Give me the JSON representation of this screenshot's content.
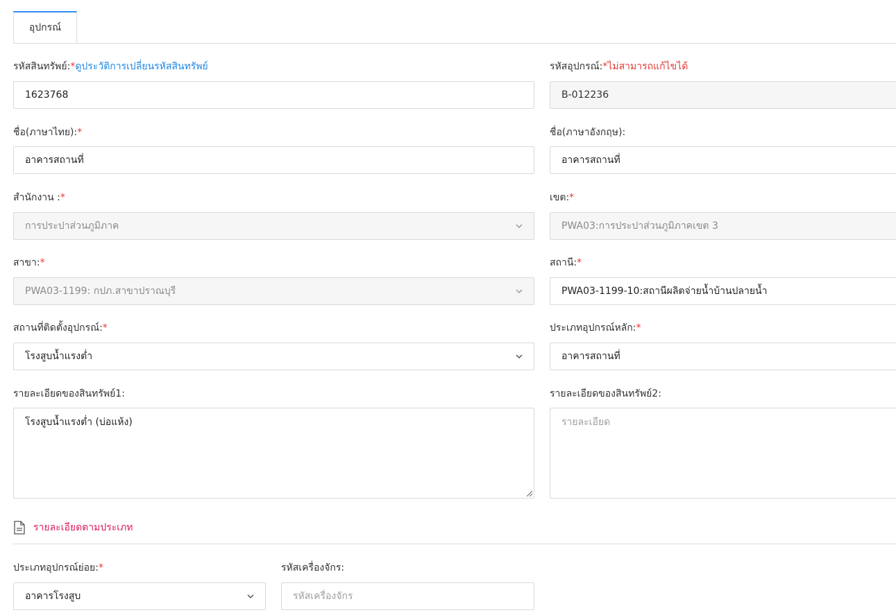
{
  "tabs": [
    {
      "label": "อุปกรณ์"
    }
  ],
  "form": {
    "asset_code": {
      "label": "รหัสสินทรัพย์:",
      "required": "*",
      "link": "ดูประวัติการเปลี่ยนรหัสสินทรัพย์",
      "value": "1623768"
    },
    "equipment_code": {
      "label": "รหัสอุปกรณ์:",
      "required": "*",
      "note": "ไม่สามารถแก้ไขได้",
      "value": "B-012236"
    },
    "name_th": {
      "label": "ชื่อ(ภาษาไทย):",
      "required": "*",
      "value": "อาคารสถานที่"
    },
    "name_en": {
      "label": "ชื่อ(ภาษาอังกฤษ):",
      "value": "อาคารสถานที่"
    },
    "office": {
      "label": "สำนักงาน :",
      "required": "*",
      "value": "การประปาส่วนภูมิภาค"
    },
    "region": {
      "label": "เขต:",
      "required": "*",
      "value": "PWA03:การประปาส่วนภูมิภาคเขต 3"
    },
    "branch": {
      "label": "สาขา:",
      "required": "*",
      "value": "PWA03-1199: กปภ.สาขาปราณบุรี"
    },
    "station": {
      "label": "สถานี:",
      "required": "*",
      "value": "PWA03-1199-10:สถานีผลิตจ่ายน้ำบ้านปลายน้ำ"
    },
    "install_location": {
      "label": "สถานที่ติดตั้งอุปกรณ์:",
      "required": "*",
      "value": "โรงสูบน้ำแรงต่ำ"
    },
    "main_type": {
      "label": "ประเภทอุปกรณ์หลัก:",
      "required": "*",
      "value": "อาคารสถานที่"
    },
    "detail1": {
      "label": "รายละเอียดของสินทรัพย์1:",
      "value": "โรงสูบน้ำแรงต่ำ (บ่อแห้ง)"
    },
    "detail2": {
      "label": "รายละเอียดของสินทรัพย์2:",
      "placeholder": "รายละเอียด"
    }
  },
  "section": {
    "title": "รายละเอียดตามประเภท",
    "icon": "document-icon"
  },
  "type_form": {
    "sub_type": {
      "label": "ประเภทอุปกรณ์ย่อย:",
      "required": "*",
      "value": "อาคารโรงสูบ"
    },
    "machine_code": {
      "label": "รหัสเครื่องจักร:",
      "placeholder": "รหัสเครื่องจักร"
    }
  },
  "icons": {
    "chevron": "chevron-down-icon"
  },
  "colors": {
    "accent": "#2d8cf0",
    "required": "#e53935",
    "link": "#1e88e5",
    "section": "#d81b60"
  }
}
